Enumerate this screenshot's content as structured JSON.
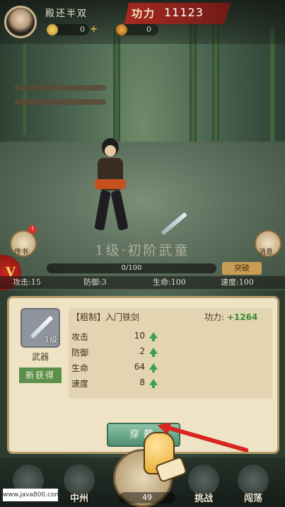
{
  "player": {
    "name": "殿还半双",
    "gold": "0",
    "ingot": "0"
  },
  "power": {
    "label": "功力",
    "value": "11123"
  },
  "side_buttons": {
    "left_label": "传书",
    "left_badge": "!",
    "right_label": "消息"
  },
  "rank_text": "1级·初阶武童",
  "xp": {
    "text": "0/100",
    "break_label": "突破",
    "progress": 0
  },
  "stats": {
    "attack": "攻击:15",
    "defense": "防御:3",
    "hp": "生命:100",
    "speed": "速度:100"
  },
  "item": {
    "type_label": "武器",
    "level_label": "1级",
    "new_label": "新获得",
    "name": "【粗制】入门铁剑",
    "power_label": "功力:",
    "power_delta": "+1264",
    "attributes": [
      {
        "label": "攻击",
        "value": "10"
      },
      {
        "label": "防御",
        "value": "2"
      },
      {
        "label": "生命",
        "value": "64"
      },
      {
        "label": "速度",
        "value": "8"
      }
    ],
    "equip_label": "穿戴"
  },
  "bottom_nav": {
    "items": [
      {
        "label": ""
      },
      {
        "label": "中州"
      },
      {
        "label": "挑战"
      },
      {
        "label": "闯荡"
      }
    ],
    "center_count": "49"
  },
  "watermark": "www.java800.com"
}
